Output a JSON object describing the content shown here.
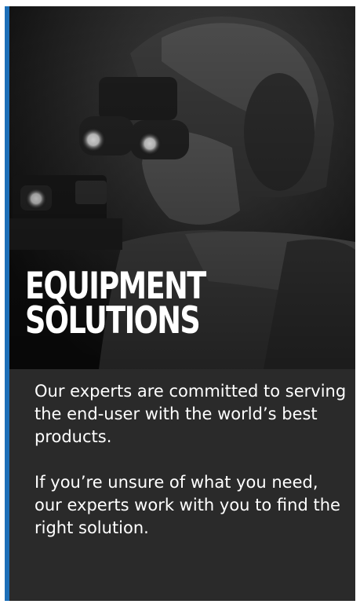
{
  "card": {
    "title_line1": "EQUIPMENT",
    "title_line2": "SOLUTIONS",
    "paragraph1": "Our experts are committed to serving the end-user with the world’s best products.",
    "paragraph2": "If you’re unsure of what you need, our experts work with you to find the right solution.",
    "accent_color": "#1d6fb8",
    "background_color": "#2a2a2a",
    "image_subject": "soldier-with-night-vision-goggles-and-weapon-light"
  }
}
